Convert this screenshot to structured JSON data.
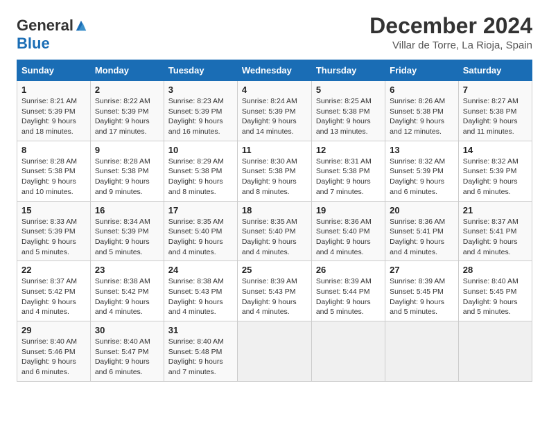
{
  "logo": {
    "general": "General",
    "blue": "Blue"
  },
  "title": "December 2024",
  "location": "Villar de Torre, La Rioja, Spain",
  "days_of_week": [
    "Sunday",
    "Monday",
    "Tuesday",
    "Wednesday",
    "Thursday",
    "Friday",
    "Saturday"
  ],
  "weeks": [
    [
      {
        "day": "1",
        "sunrise": "8:21 AM",
        "sunset": "5:39 PM",
        "daylight": "9 hours and 18 minutes."
      },
      {
        "day": "2",
        "sunrise": "8:22 AM",
        "sunset": "5:39 PM",
        "daylight": "9 hours and 17 minutes."
      },
      {
        "day": "3",
        "sunrise": "8:23 AM",
        "sunset": "5:39 PM",
        "daylight": "9 hours and 16 minutes."
      },
      {
        "day": "4",
        "sunrise": "8:24 AM",
        "sunset": "5:39 PM",
        "daylight": "9 hours and 14 minutes."
      },
      {
        "day": "5",
        "sunrise": "8:25 AM",
        "sunset": "5:38 PM",
        "daylight": "9 hours and 13 minutes."
      },
      {
        "day": "6",
        "sunrise": "8:26 AM",
        "sunset": "5:38 PM",
        "daylight": "9 hours and 12 minutes."
      },
      {
        "day": "7",
        "sunrise": "8:27 AM",
        "sunset": "5:38 PM",
        "daylight": "9 hours and 11 minutes."
      }
    ],
    [
      {
        "day": "8",
        "sunrise": "8:28 AM",
        "sunset": "5:38 PM",
        "daylight": "9 hours and 10 minutes."
      },
      {
        "day": "9",
        "sunrise": "8:28 AM",
        "sunset": "5:38 PM",
        "daylight": "9 hours and 9 minutes."
      },
      {
        "day": "10",
        "sunrise": "8:29 AM",
        "sunset": "5:38 PM",
        "daylight": "9 hours and 8 minutes."
      },
      {
        "day": "11",
        "sunrise": "8:30 AM",
        "sunset": "5:38 PM",
        "daylight": "9 hours and 8 minutes."
      },
      {
        "day": "12",
        "sunrise": "8:31 AM",
        "sunset": "5:38 PM",
        "daylight": "9 hours and 7 minutes."
      },
      {
        "day": "13",
        "sunrise": "8:32 AM",
        "sunset": "5:39 PM",
        "daylight": "9 hours and 6 minutes."
      },
      {
        "day": "14",
        "sunrise": "8:32 AM",
        "sunset": "5:39 PM",
        "daylight": "9 hours and 6 minutes."
      }
    ],
    [
      {
        "day": "15",
        "sunrise": "8:33 AM",
        "sunset": "5:39 PM",
        "daylight": "9 hours and 5 minutes."
      },
      {
        "day": "16",
        "sunrise": "8:34 AM",
        "sunset": "5:39 PM",
        "daylight": "9 hours and 5 minutes."
      },
      {
        "day": "17",
        "sunrise": "8:35 AM",
        "sunset": "5:40 PM",
        "daylight": "9 hours and 4 minutes."
      },
      {
        "day": "18",
        "sunrise": "8:35 AM",
        "sunset": "5:40 PM",
        "daylight": "9 hours and 4 minutes."
      },
      {
        "day": "19",
        "sunrise": "8:36 AM",
        "sunset": "5:40 PM",
        "daylight": "9 hours and 4 minutes."
      },
      {
        "day": "20",
        "sunrise": "8:36 AM",
        "sunset": "5:41 PM",
        "daylight": "9 hours and 4 minutes."
      },
      {
        "day": "21",
        "sunrise": "8:37 AM",
        "sunset": "5:41 PM",
        "daylight": "9 hours and 4 minutes."
      }
    ],
    [
      {
        "day": "22",
        "sunrise": "8:37 AM",
        "sunset": "5:42 PM",
        "daylight": "9 hours and 4 minutes."
      },
      {
        "day": "23",
        "sunrise": "8:38 AM",
        "sunset": "5:42 PM",
        "daylight": "9 hours and 4 minutes."
      },
      {
        "day": "24",
        "sunrise": "8:38 AM",
        "sunset": "5:43 PM",
        "daylight": "9 hours and 4 minutes."
      },
      {
        "day": "25",
        "sunrise": "8:39 AM",
        "sunset": "5:43 PM",
        "daylight": "9 hours and 4 minutes."
      },
      {
        "day": "26",
        "sunrise": "8:39 AM",
        "sunset": "5:44 PM",
        "daylight": "9 hours and 5 minutes."
      },
      {
        "day": "27",
        "sunrise": "8:39 AM",
        "sunset": "5:45 PM",
        "daylight": "9 hours and 5 minutes."
      },
      {
        "day": "28",
        "sunrise": "8:40 AM",
        "sunset": "5:45 PM",
        "daylight": "9 hours and 5 minutes."
      }
    ],
    [
      {
        "day": "29",
        "sunrise": "8:40 AM",
        "sunset": "5:46 PM",
        "daylight": "9 hours and 6 minutes."
      },
      {
        "day": "30",
        "sunrise": "8:40 AM",
        "sunset": "5:47 PM",
        "daylight": "9 hours and 6 minutes."
      },
      {
        "day": "31",
        "sunrise": "8:40 AM",
        "sunset": "5:48 PM",
        "daylight": "9 hours and 7 minutes."
      },
      null,
      null,
      null,
      null
    ]
  ],
  "labels": {
    "sunrise": "Sunrise:",
    "sunset": "Sunset:",
    "daylight": "Daylight:"
  }
}
